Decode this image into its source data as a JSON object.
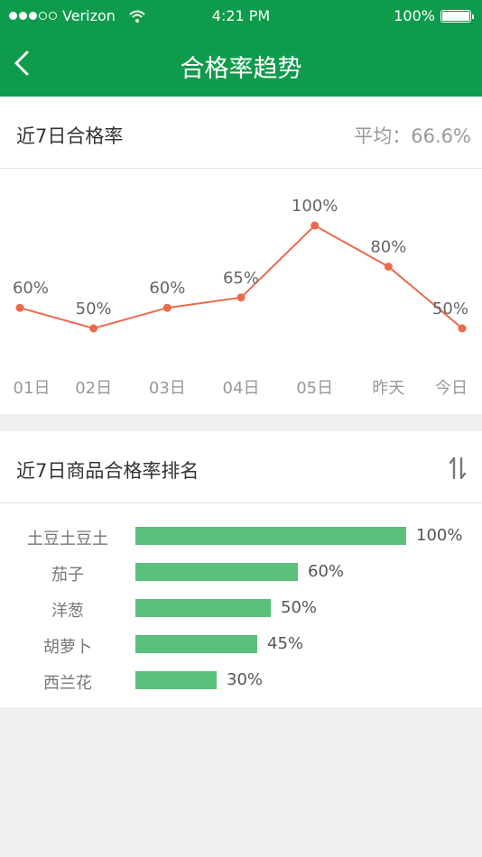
{
  "status_bar": {
    "carrier": "Verizon",
    "signal_bars_filled": 3,
    "signal_bars_total": 5,
    "time": "4:21 PM",
    "battery": "100%"
  },
  "nav": {
    "title": "合格率趋势"
  },
  "trend": {
    "title": "近7日合格率",
    "average": "平均：66.6%",
    "chart_data": {
      "type": "line",
      "categories": [
        "01日",
        "02日",
        "03日",
        "04日",
        "05日",
        "昨天",
        "今日"
      ],
      "values": [
        60,
        50,
        60,
        65,
        100,
        80,
        50
      ],
      "value_labels": [
        "60%",
        "50%",
        "60%",
        "65%",
        "100%",
        "80%",
        "50%"
      ],
      "ylim": [
        0,
        100
      ],
      "grid": false,
      "color": "#ec6a4c"
    }
  },
  "ranking": {
    "title": "近7日商品合格率排名",
    "bar_color": "#5ac07b",
    "items": [
      {
        "name": "土豆土豆土",
        "value": 100,
        "label": "100%"
      },
      {
        "name": "茄子",
        "value": 60,
        "label": "60%"
      },
      {
        "name": "洋葱",
        "value": 50,
        "label": "50%"
      },
      {
        "name": "胡萝卜",
        "value": 45,
        "label": "45%"
      },
      {
        "name": "西兰花",
        "value": 30,
        "label": "30%"
      }
    ]
  }
}
